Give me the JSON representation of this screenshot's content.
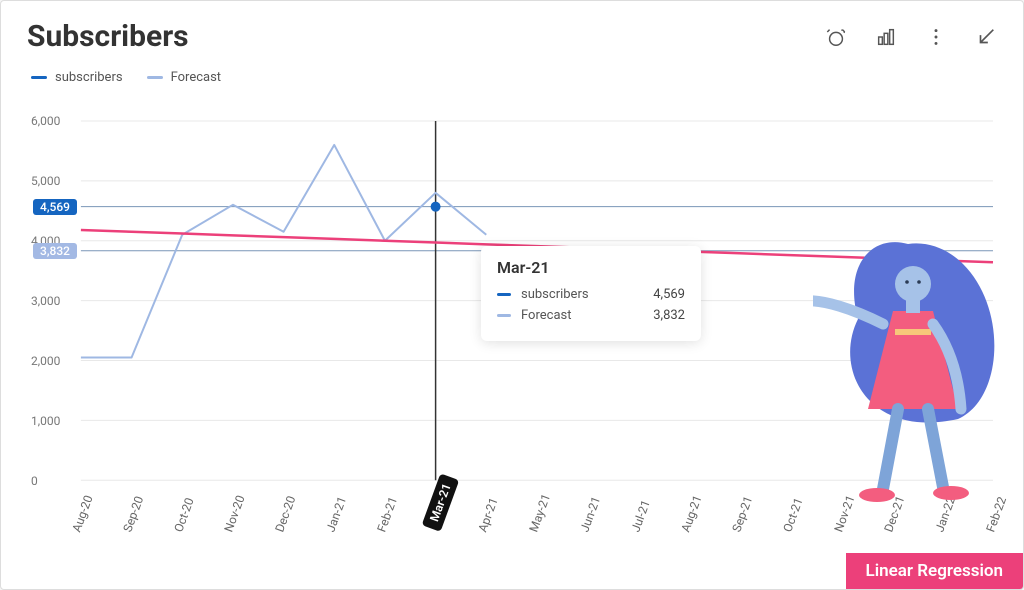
{
  "title": "Subscribers",
  "legend": {
    "subscribers": {
      "label": "subscribers",
      "color": "#1565C0"
    },
    "forecast": {
      "label": "Forecast",
      "color": "#9FB8E3"
    }
  },
  "toolbar": {
    "alarm": "alarm-icon",
    "bars": "bar-chart-icon",
    "more": "more-icon",
    "collapse": "collapse-icon"
  },
  "regression_label": "Linear Regression",
  "tooltip": {
    "title": "Mar-21",
    "rows": [
      {
        "label": "subscribers",
        "value": "4,569",
        "color": "#1565C0"
      },
      {
        "label": "Forecast",
        "value": "3,832",
        "color": "#9FB8E3"
      }
    ]
  },
  "badges": {
    "subscribers": "4,569",
    "forecast": "3,832"
  },
  "y_ticks": [
    "0",
    "1,000",
    "2,000",
    "3,000",
    "4,000",
    "5,000",
    "6,000"
  ],
  "colors": {
    "subscribers_line": "#1565C0",
    "forecast_line": "#9FB8E3",
    "regression_line": "#EC407A",
    "forecast_badge": "#A3B9E4",
    "subscribers_badge": "#1565C0",
    "vertical_rule": "#333",
    "grid": "#e8e8e8",
    "highlight_ref": "#7a96b7"
  },
  "chart_data": {
    "type": "line",
    "title": "Subscribers",
    "xlabel": "",
    "ylabel": "",
    "ylim": [
      0,
      6000
    ],
    "categories": [
      "Aug-20",
      "Sep-20",
      "Oct-20",
      "Nov-20",
      "Dec-20",
      "Jan-21",
      "Feb-21",
      "Mar-21",
      "Apr-21",
      "May-21",
      "Jun-21",
      "Jul-21",
      "Aug-21",
      "Sep-21",
      "Oct-21",
      "Nov-21",
      "Dec-21",
      "Jan-22",
      "Feb-22"
    ],
    "highlight_index": 7,
    "series": [
      {
        "name": "subscribers",
        "color": "#1565C0",
        "values": [
          null,
          null,
          null,
          null,
          null,
          null,
          null,
          4569,
          null,
          null,
          null,
          null,
          null,
          null,
          null,
          null,
          null,
          null,
          null
        ]
      },
      {
        "name": "Forecast",
        "color": "#9FB8E3",
        "values": [
          2050,
          2050,
          4100,
          4600,
          4150,
          5600,
          4000,
          4800,
          4100,
          null,
          null,
          null,
          null,
          null,
          null,
          null,
          null,
          null,
          null
        ]
      },
      {
        "name": "Linear Regression",
        "color": "#EC407A",
        "values": [
          4180,
          4150,
          4120,
          4090,
          4060,
          4030,
          4000,
          3970,
          3940,
          3910,
          3880,
          3850,
          3820,
          3790,
          3760,
          3730,
          3700,
          3670,
          3640
        ]
      }
    ],
    "reference_lines": [
      {
        "y": 4569,
        "label": "4,569",
        "color": "#1565C0"
      },
      {
        "y": 3832,
        "label": "3,832",
        "color": "#A3B9E4"
      }
    ],
    "grid": true,
    "legend_position": "top-left"
  }
}
